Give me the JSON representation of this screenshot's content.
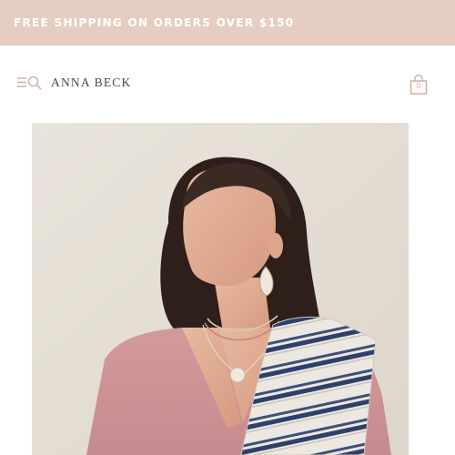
{
  "promo": {
    "text": "FREE SHIPPING ON ORDERS OVER $150"
  },
  "header": {
    "brand": "ANNA BECK",
    "cart_count": "0",
    "icons": [
      "menu-icon",
      "search-icon",
      "shopping-bag-icon"
    ]
  },
  "colors": {
    "promo_bg": "#e5cdc1",
    "brand_text": "#444a52",
    "icon_accent": "#d5b5a8"
  },
  "hero": {
    "image": "model-wearing-layered-necklaces-and-teardrop-earrings"
  }
}
